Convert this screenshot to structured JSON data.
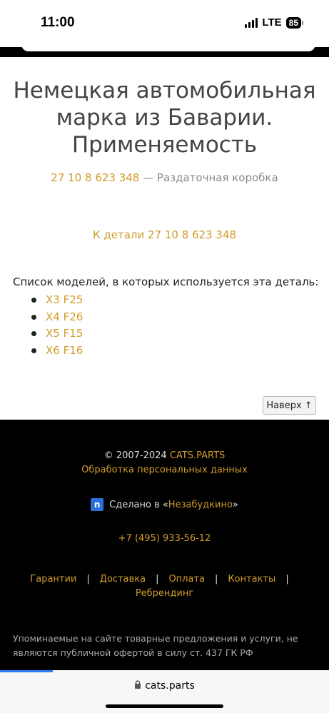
{
  "status": {
    "time": "11:00",
    "network": "LTE",
    "battery": "85"
  },
  "main": {
    "title": "Немецкая автомобильная марка из Баварии. Применяемость",
    "part_number": "27 10 8 623 348",
    "part_desc": " — Раздаточная коробка",
    "detail_link": "К детали 27 10 8 623 348",
    "models_intro": "Список моделей, в которых используется эта деталь:",
    "models": [
      "X3 F25",
      "X4 F26",
      "X5 F15",
      "X6 F16"
    ],
    "top_button": "Наверх ↑"
  },
  "footer": {
    "copyright_prefix": "© 2007-2024 ",
    "copyright_brand": "CATS.PARTS",
    "privacy": "Обработка персональных данных",
    "made_prefix": "Сделано в «",
    "made_link": "Незабудкино",
    "made_suffix": "»",
    "phone": "+7 (495) 933-56-12",
    "links": [
      "Гарантии",
      "Доставка",
      "Оплата",
      "Контакты",
      "Ребрендинг"
    ],
    "disclaimer": "Упоминаемые на сайте товарные предложения и услуги, не являются публичной офертой в силу ст. 437 ГК РФ"
  },
  "browser": {
    "url": "cats.parts",
    "load_progress": 0.16
  },
  "colors": {
    "link": "#d09b2c",
    "footer_bg": "#000000",
    "progress": "#2d7cf6"
  }
}
